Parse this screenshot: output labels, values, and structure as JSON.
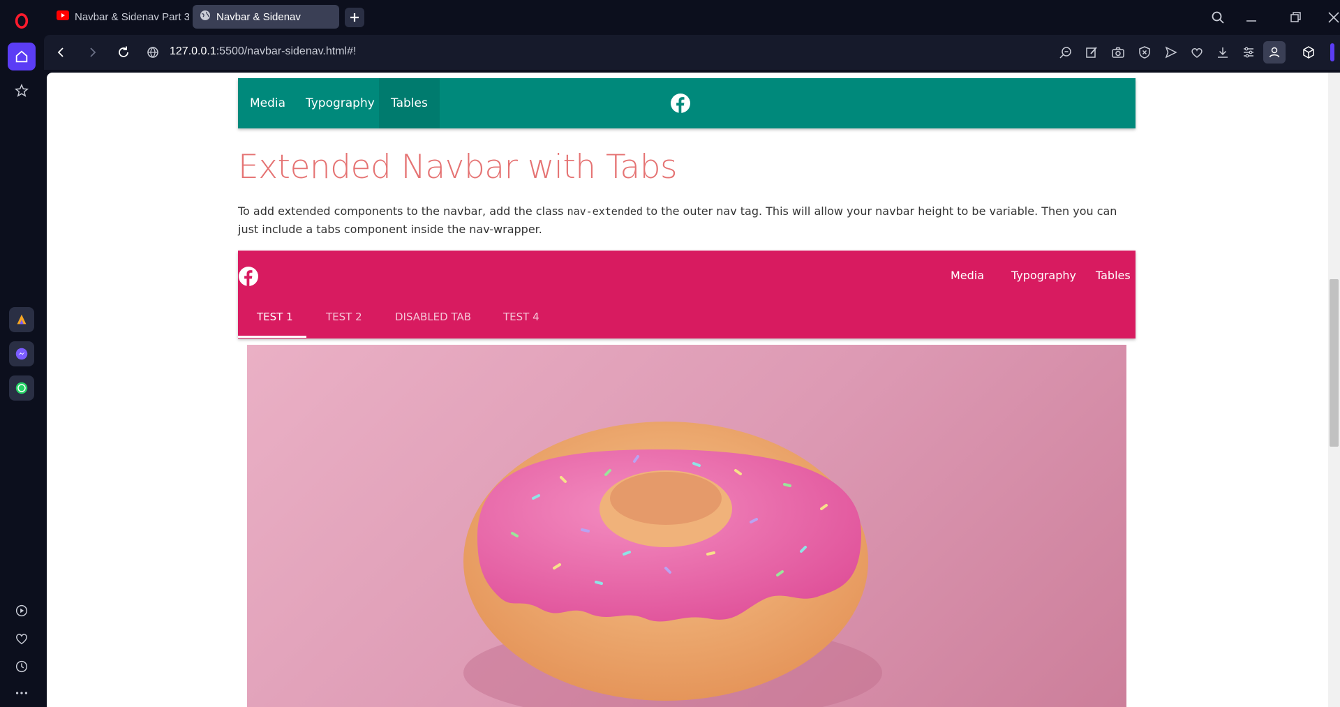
{
  "browser": {
    "tabs": [
      {
        "title": "Navbar & Sidenav Part 3",
        "icon": "youtube-icon"
      },
      {
        "title": "Navbar & Sidenav",
        "icon": "globe-icon"
      }
    ],
    "url_host": "127.0.0.1",
    "url_rest": ":5500/navbar-sidenav.html#!"
  },
  "page": {
    "teal_nav": {
      "links": [
        "Media",
        "Typography",
        "Tables"
      ],
      "color": "#00897b"
    },
    "title": "Extended Navbar with Tabs",
    "desc_part1": "To add extended components to the navbar, add the class ",
    "desc_code": "nav-extended",
    "desc_part2": " to the outer nav tag. This will allow your navbar height to be variable. Then you can just include a tabs component inside the nav-wrapper.",
    "pink_nav": {
      "links": [
        "Media",
        "Typography",
        "Tables"
      ],
      "tabs": [
        "TEST 1",
        "TEST 2",
        "DISABLED TAB",
        "TEST 4"
      ],
      "color": "#d81b60"
    }
  }
}
